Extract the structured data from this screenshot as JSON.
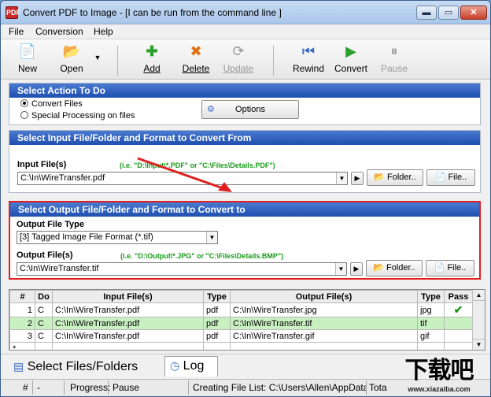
{
  "window": {
    "title": "Convert PDF to Image - [I can be run from the command line ]",
    "min": "▬",
    "max": "▭",
    "close": "✕",
    "app_icon": "PDF"
  },
  "menu": [
    "File",
    "Conversion",
    "Help"
  ],
  "toolbar": [
    {
      "label": "New",
      "icon": "📄"
    },
    {
      "label": "Open",
      "icon": "📂"
    },
    {
      "label": "Add",
      "icon": "✚"
    },
    {
      "label": "Delete",
      "icon": "✖"
    },
    {
      "label": "Update",
      "icon": "⟳"
    },
    {
      "label": "Rewind",
      "icon": "⏮"
    },
    {
      "label": "Convert",
      "icon": "▶"
    },
    {
      "label": "Pause",
      "icon": "⏸"
    }
  ],
  "action": {
    "header": "Select Action To Do",
    "opt1": "Convert Files",
    "opt2": "Special Processing on files",
    "options_button": "Options"
  },
  "input": {
    "header": "Select Input File/Folder and Format to Convert From",
    "label": "Input File(s)",
    "hint": "(i.e. \"D:\\Input\\*.PDF\"  or  \"C:\\Files\\Details.PDF\")",
    "value": "C:\\In\\WireTransfer.pdf",
    "folder_button": "Folder..",
    "file_button": "File.."
  },
  "output": {
    "header": "Select Output File/Folder and Format to Convert to",
    "type_label": "Output File Type",
    "type_value": "[3] Tagged Image File Format (*.tif)",
    "label": "Output File(s)",
    "hint": "(i.e. \"D:\\Output\\*.JPG\"  or  \"C:\\Files\\Details.BMP\")",
    "value": "C:\\In\\WireTransfer.tif",
    "folder_button": "Folder..",
    "file_button": "File.."
  },
  "table": {
    "headers": [
      "#",
      "Do",
      "Input File(s)",
      "Type",
      "Output File(s)",
      "Type",
      "Pass"
    ],
    "rows": [
      {
        "n": "1",
        "do": "C",
        "in": "C:\\In\\WireTransfer.pdf",
        "itype": "pdf",
        "out": "C:\\In\\WireTransfer.jpg",
        "otype": "jpg",
        "pass": "✔"
      },
      {
        "n": "2",
        "do": "C",
        "in": "C:\\In\\WireTransfer.pdf",
        "itype": "pdf",
        "out": "C:\\In\\WireTransfer.tif",
        "otype": "tif",
        "pass": ""
      },
      {
        "n": "3",
        "do": "C",
        "in": "C:\\In\\WireTransfer.pdf",
        "itype": "pdf",
        "out": "C:\\In\\WireTransfer.gif",
        "otype": "gif",
        "pass": ""
      },
      {
        "n": "*",
        "do": "",
        "in": "",
        "itype": "",
        "out": "",
        "otype": "",
        "pass": ""
      }
    ]
  },
  "tabs": {
    "files": "Select Files/Folders",
    "log": "Log"
  },
  "status": {
    "hash": "#",
    "dash": "-",
    "progress": "Progress:",
    "pause": "Pause",
    "creating": "Creating File List: C:\\Users\\Allen\\AppData\\",
    "tot": "Tota"
  },
  "watermark": {
    "big": "下载吧",
    "url": "www.xiazaiba.com"
  }
}
